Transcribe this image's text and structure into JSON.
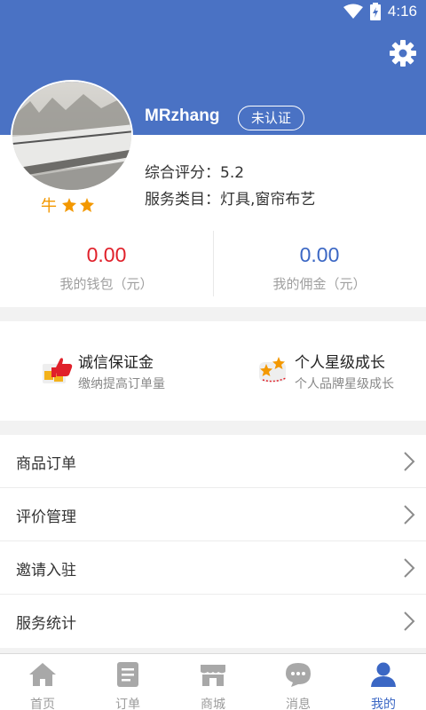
{
  "status_bar": {
    "time": "4:16"
  },
  "profile": {
    "username": "MRzhang",
    "verification_badge": "未认证",
    "level_label": "牛",
    "rating_label": "综合评分：",
    "rating_value": "5.2",
    "service_label": "服务类目：",
    "service_value": "灯具,窗帘布艺"
  },
  "stats": [
    {
      "value": "0.00",
      "label": "我的钱包（元）",
      "color": "#e0202a"
    },
    {
      "value": "0.00",
      "label": "我的佣金（元）",
      "color": "#3b67c4"
    }
  ],
  "promos": [
    {
      "title": "诚信保证金",
      "subtitle": "缴纳提高订单量",
      "icon": "thumbs-up-icon"
    },
    {
      "title": "个人星级成长",
      "subtitle": "个人品牌星级成长",
      "icon": "star-growth-icon"
    }
  ],
  "menu": [
    {
      "label": "商品订单"
    },
    {
      "label": "评价管理"
    },
    {
      "label": "邀请入驻"
    },
    {
      "label": "服务统计"
    }
  ],
  "tabs": [
    {
      "label": "首页",
      "icon": "home-icon"
    },
    {
      "label": "订单",
      "icon": "order-icon"
    },
    {
      "label": "商城",
      "icon": "store-icon"
    },
    {
      "label": "消息",
      "icon": "message-icon"
    },
    {
      "label": "我的",
      "icon": "profile-icon",
      "active": true
    }
  ],
  "colors": {
    "header": "#4a72c4",
    "accent": "#3b67c4",
    "star": "#f39800"
  }
}
